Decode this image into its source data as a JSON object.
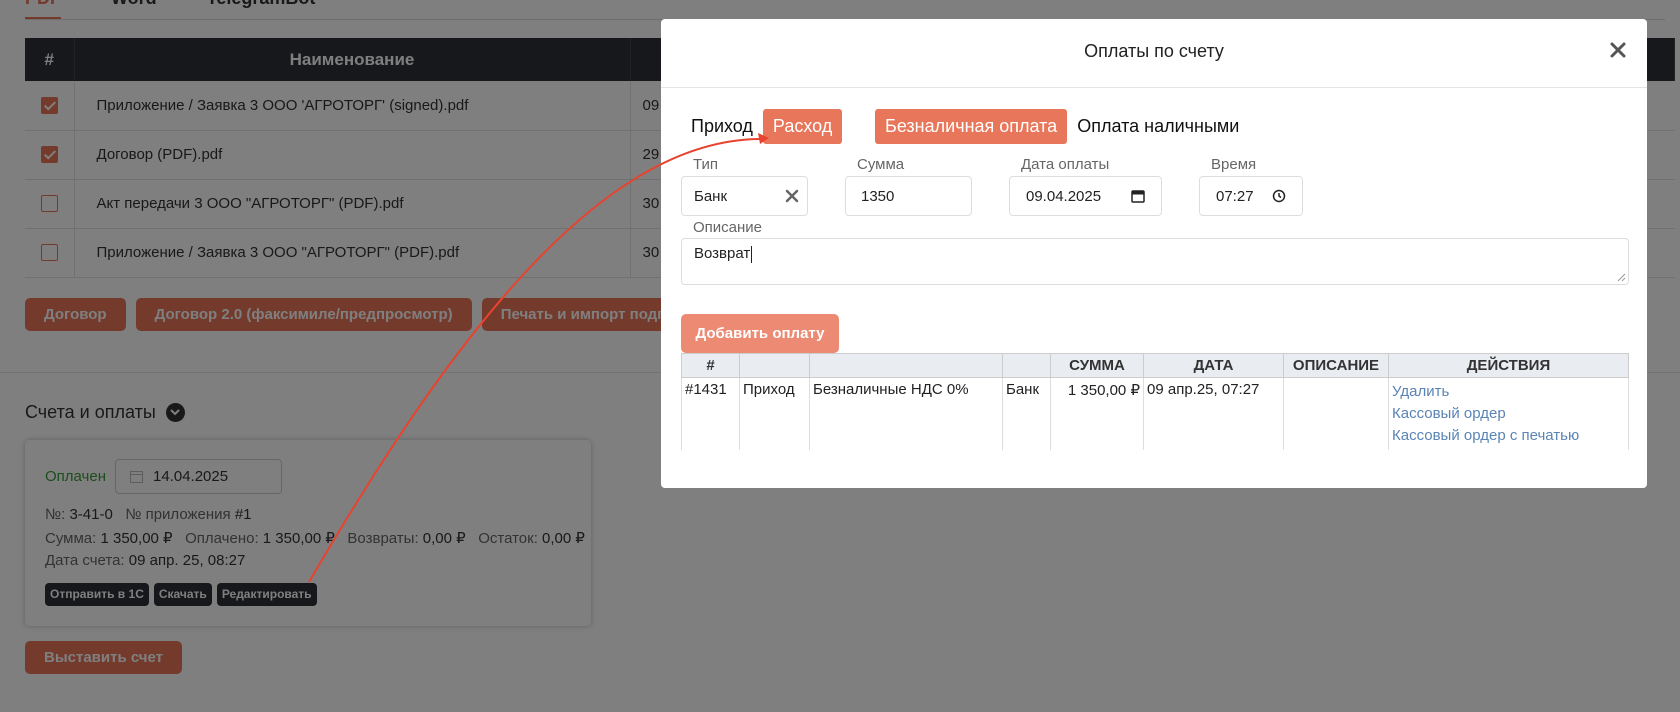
{
  "tabs": [
    "PDF",
    "Word",
    "TelegramBot"
  ],
  "docs_table": {
    "headers": [
      "#",
      "Наименование"
    ],
    "rows": [
      {
        "checked": true,
        "name": "Приложение / Заявка 3 ООО 'АГРОТОРГ' (signed).pdf",
        "date": "09"
      },
      {
        "checked": true,
        "name": "Договор (PDF).pdf",
        "date": "29"
      },
      {
        "checked": false,
        "name": "Акт передачи 3 ООО \"АГРОТОРГ\" (PDF).pdf",
        "date": "30"
      },
      {
        "checked": false,
        "name": "Приложение / Заявка 3 ООО \"АГРОТОРГ\" (PDF).pdf",
        "date": "30"
      }
    ]
  },
  "doc_buttons": [
    "Договор",
    "Договор 2.0 (факсимиле/предпросмотр)",
    "Печать и импорт подпис"
  ],
  "section": {
    "title": "Счета и оплаты"
  },
  "invoice": {
    "status": "Оплачен",
    "date": "14.04.2025",
    "number_label": "№:",
    "number": "3-41-0",
    "appendix_label": "№ приложения",
    "appendix": "#1",
    "sum_label": "Сумма:",
    "sum": "1 350,00 ₽",
    "paid_label": "Оплачено:",
    "paid": "1 350,00 ₽",
    "returns_label": "Возвраты:",
    "returns": "0,00 ₽",
    "rest_label": "Остаток:",
    "rest": "0,00 ₽",
    "invoice_date_label": "Дата счета:",
    "invoice_date": "09 апр. 25, 08:27",
    "actions": [
      "Отправить в 1С",
      "Скачать",
      "Редактировать"
    ]
  },
  "issue_button": "Выставить счет",
  "modal": {
    "title": "Оплаты по счету",
    "direction": {
      "income": "Приход",
      "expense": "Расход",
      "selected": "Расход"
    },
    "method": {
      "cashless": "Безналичная оплата",
      "cash": "Оплата наличными",
      "selected": "Безналичная оплата"
    },
    "fields": {
      "type_label": "Тип",
      "type_value": "Банк",
      "sum_label": "Сумма",
      "sum_value": "1350",
      "date_label": "Дата оплаты",
      "date_value": "09.04.2025",
      "time_label": "Время",
      "time_value": "07:27",
      "desc_label": "Описание",
      "desc_value": "Возврат"
    },
    "add_button": "Добавить оплату",
    "table": {
      "headers": [
        "#",
        "",
        "",
        "",
        "СУММА",
        "ДАТА",
        "ОПИСАНИЕ",
        "ДЕЙСТВИЯ"
      ],
      "rows": [
        {
          "id": "#1431",
          "direction": "Приход",
          "method": "Безналичные НДС 0%",
          "type": "Банк",
          "sum": "1 350,00 ₽",
          "date": "09 апр.25, 07:27",
          "description": "",
          "actions": [
            "Удалить",
            "Кассовый ордер",
            "Кассовый ордер с печатью"
          ]
        }
      ]
    }
  },
  "colors": {
    "accent": "#e8765b",
    "dark": "#2c3036",
    "paid_green": "#3a9c3a",
    "link": "#5a84b5",
    "annotation_arrow": "#e8432e"
  }
}
